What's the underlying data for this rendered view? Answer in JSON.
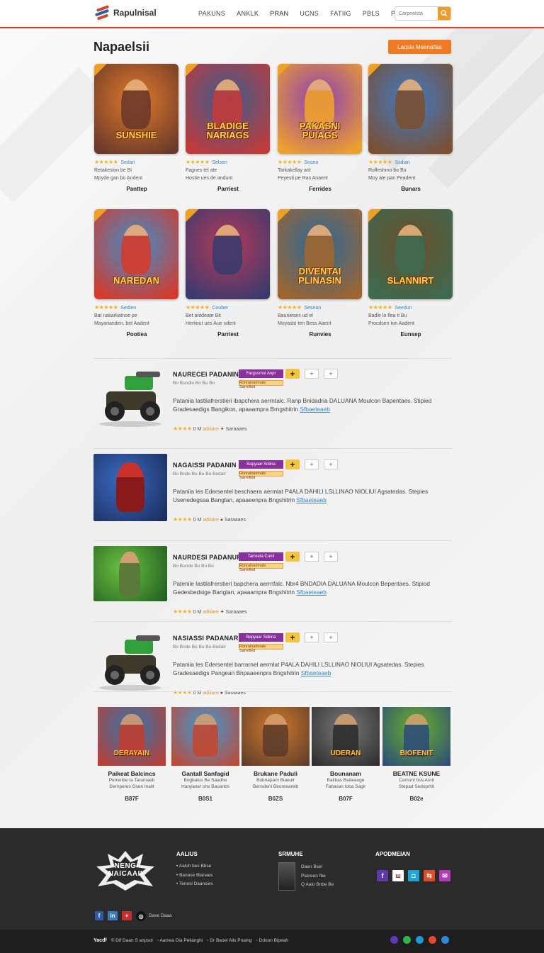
{
  "header": {
    "logo_text": "Rapulnisal",
    "nav": [
      "PAKUNS",
      "ANKLK",
      "PRAN",
      "UCNS",
      "FATIIG",
      "PBLS",
      "PBENBD"
    ],
    "active_nav": 2,
    "search_placeholder": "Carpnelsta"
  },
  "page": {
    "title": "Napaelsii",
    "cta_label": "Laqsla Meanalfas"
  },
  "grid_cards": [
    {
      "thumb_text": "SUNSHIE",
      "stars": "★★★★★",
      "label": "Sedari",
      "desc1": "Retakeslon be Bi",
      "desc2": "Mpyde gan bo Andent",
      "name": "Panttep",
      "color1": "#e27a2a",
      "color2": "#6b3a2a"
    },
    {
      "thumb_text": "BLADIGE NARIAGS",
      "stars": "★★★★★",
      "label": "Selsen",
      "desc1": "Fagnes tel ate",
      "desc2": "Hostie ues de andunt",
      "name": "Parriest",
      "color1": "#3a5d8f",
      "color2": "#c23a3a"
    },
    {
      "thumb_text": "PAKASNI PUIAGS",
      "stars": "★★★★★",
      "label": "Sosea",
      "desc1": "Tarkakellay arit",
      "desc2": "Peyesti pe Ras Anaent",
      "name": "Ferrides",
      "color1": "#8a3fb7",
      "color2": "#f0a12a"
    },
    {
      "thumb_text": "",
      "stars": "★★★★★",
      "label": "Ssdian",
      "desc1": "Rofleshmo bo Bu",
      "desc2": "Moy ale pan Peadent",
      "name": "Bunars",
      "color1": "#3f7bc6",
      "color2": "#7b4f30"
    },
    {
      "thumb_text": "NAREDAN",
      "stars": "★★★★★",
      "label": "Sedien",
      "desc1": "Bat nakarkatnoe pe",
      "desc2": "Mayarianden, bet Aadent",
      "name": "Pootiea",
      "color1": "#3a8fd0",
      "color2": "#d63a2a"
    },
    {
      "thumb_text": "",
      "stars": "★★★★★",
      "label": "Couber",
      "desc1": "Bet antdeate Bit",
      "desc2": "Hertiout ues Aue sdent",
      "name": "Parriest",
      "color1": "#b33a58",
      "color2": "#3b3a6e"
    },
    {
      "thumb_text": "DIVENTAI PLINASIN",
      "stars": "★★★★★",
      "label": "Sesean",
      "desc1": "Baunieses ud el",
      "desc2": "Moyasto ten Bess Aaent",
      "name": "Runvies",
      "color1": "#2a6a9a",
      "color2": "#a0652e"
    },
    {
      "thumb_text": "SLANNIRT",
      "stars": "★★★★★",
      "label": "Seedun",
      "desc1": "Badle lo flea ti Bu",
      "desc2": "Procdsen ton Aadent",
      "name": "Eunsep",
      "color1": "#6a4e2c",
      "color2": "#3d6b4f"
    }
  ],
  "list_items": [
    {
      "title": "NAURECEI PADANIN",
      "sub": "Bo Bundlo Bo Bu Bo",
      "tag1": "Fargssmul Anpr",
      "tag2": "Ronrainarimale Sarrefied",
      "text": "Pataniia lastilafrerstieri ibapchera aerrntalc. Ranp Bnidadria DALUANA Moulcon Bapentaes. Stipied Gradesaedigs Bangikon, apaaampra Brngshitrin",
      "link": "Sfbaeteaeb",
      "rating_text": "0 M",
      "foot_orange": "adiiiare",
      "foot_tail": "Saraaaes",
      "foot_icon": "✦",
      "img_type": "vehicle"
    },
    {
      "title": "NAGAISSI PADANIN",
      "sub": "Bo Bnde Bo Bu Bo Bedair",
      "tag1": "Bapyaar Sdiina",
      "tag2": "Ronrainarimale Sarrefied",
      "text": "Pataniia les Edersentel beschaera aermlat P4ALA DAHILI LSLLINAO NIOLIUI Agsatedas. Stepies Usenedegsaa Banglan, apaaeenpra Bngshitrin",
      "link": "Sfbaeteaeb",
      "rating_text": "0 M",
      "foot_orange": "adiiiare",
      "foot_tail": "Saraaaes",
      "foot_icon": "●",
      "img_type": "hero"
    },
    {
      "title": "NAURDESI PADANUR",
      "sub": "Bo Bunde Bo Bu Bo",
      "tag1": "Tarreeta Cunil",
      "tag2": "Ronrainarimale Sarrefied",
      "text": "Pateniie lastilafrerstieri bapchera aerrnfalc. Nbr4 BNDADIA DALUANA Moulcon Bepentaes. Stipiod Gedesbedsige Banglan, apaaampra Bngshitrin",
      "link": "Sfbaeteaeb",
      "rating_text": "0 M",
      "foot_orange": "adiiiare",
      "foot_tail": "Saraaaes",
      "foot_icon": "✦",
      "img_type": "soldier"
    },
    {
      "title": "NASIASSI PADANAR",
      "sub": "Bo Bnde Bo Bu Bo Bedair",
      "tag1": "Bapyaar Sdiiina",
      "tag2": "Ronrainarimale Sarrefied",
      "text": "Pataniia les Edersentel barrarnel aermlat P4ALA DAHILI LSLLINAO NIOLIUI Agsatedas. Stepies Gradesaedigs Pangean Bnpaaeenpra Bngshitrin",
      "link": "Sfbaeteaeb",
      "rating_text": "0 M",
      "foot_orange": "adiiiare",
      "foot_tail": "Saraaaes",
      "foot_icon": "●",
      "img_type": "vehicle"
    }
  ],
  "recommended": [
    {
      "img_text": "DERAYAIN",
      "name": "Paikeat Balcincs",
      "d1": "Perrenbe ta Tarumaeb",
      "d2": "Dernperes Osen Inalit",
      "price": "B87F",
      "c1": "#2d78b0",
      "c2": "#c73a2a"
    },
    {
      "img_text": "",
      "name": "Gantall Sanfagid",
      "d1": "Bogbalos Be Saadhe",
      "d2": "Hanyaner ons Bauanbs",
      "price": "B0S1",
      "c1": "#3a9ad6",
      "c2": "#c9442a"
    },
    {
      "img_text": "",
      "name": "Brukane Paduli",
      "d1": "Bobnaparn Biaeuir",
      "d2": "Bensdeni Beonrearelit",
      "price": "B0ZS",
      "c1": "#d07a2a",
      "c2": "#5a3a2a"
    },
    {
      "img_text": "UDERAN",
      "name": "Bounanam",
      "d1": "Balibas Bedeauge",
      "d2": "Fabasan toba Sagir",
      "price": "B07F",
      "c1": "#7a7a7a",
      "c2": "#2a2a2a"
    },
    {
      "img_text": "BIOFENIT",
      "name": "BEATNE KSUNE",
      "d1": "Comunt bos Arnit",
      "d2": "Stepad Sedoprhit",
      "price": "B02e",
      "c1": "#6ab02a",
      "c2": "#2a4a7a"
    }
  ],
  "footer": {
    "logo_text": "NENG NAICAAII",
    "col1_title": "AALIUS",
    "col1_items": [
      "Aaluh bes Bbse",
      "Banase Blanaes",
      "Tenesl Daansies"
    ],
    "col2_title": "SRMUHE",
    "col2_lines": [
      "Daen Bsel",
      "Pianeen fbe",
      "Q Aalo Bnbe Be"
    ],
    "col3_title": "APODMEIAN",
    "social_label": "Daxe Daaa",
    "bottom_brand": "Yacdf",
    "bottom_links": [
      "Dif Daan S anpsol",
      "Aamea Dia Pelianghi",
      "Dr Baoel Ails Pnaing",
      "Ddoon Bipeah"
    ]
  },
  "colors": {
    "accent": "#d9432b",
    "orange": "#ef7a22",
    "star": "#f3b21b",
    "link": "#3b86c6",
    "footer_bg": "#2b2b2b"
  }
}
